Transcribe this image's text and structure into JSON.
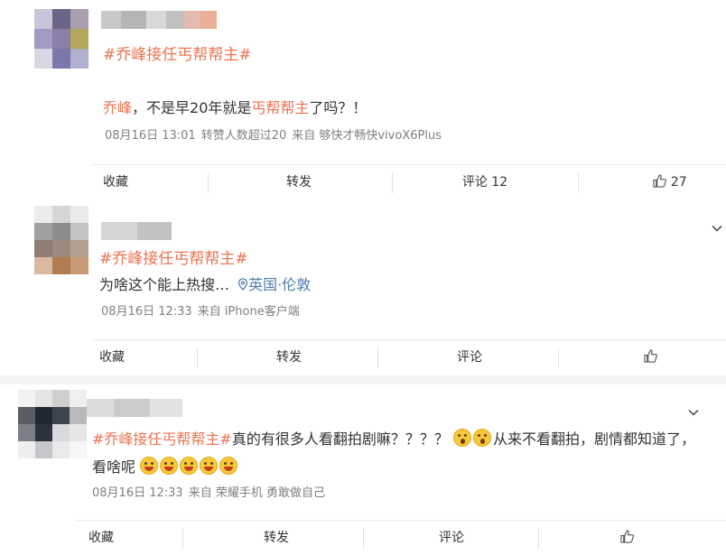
{
  "posts": [
    {
      "topic": "#乔峰接任丐帮帮主#",
      "text": {
        "part1": "乔峰",
        "part2": "，不是早20年就是",
        "part3": "丐帮帮主",
        "part4": "了吗？！"
      },
      "meta": {
        "time": "08月16日 13:01",
        "extra": "转赞人数超过20",
        "source": "来自 够快才畅快vivoX6Plus"
      },
      "actions": {
        "favorite": "收藏",
        "forward": "转发",
        "comment": "评论 12",
        "like_count": "27"
      }
    },
    {
      "topic": "#乔峰接任丐帮帮主#",
      "text": {
        "body": "为啥这个能上热搜…",
        "location": "英国·伦敦"
      },
      "meta": {
        "time": "08月16日 12:33",
        "source": "来自 iPhone客户端"
      },
      "actions": {
        "favorite": "收藏",
        "forward": "转发",
        "comment": "评论",
        "like_count": ""
      }
    },
    {
      "topic": "#乔峰接任丐帮帮主#",
      "text": {
        "line1": "真的有很多人看翻拍剧嘛？？？？",
        "line1b": "从来不看翻拍，剧情都知道了，",
        "line2": "看啥呢"
      },
      "meta": {
        "time": "08月16日 12:33",
        "source": "来自 荣耀手机 勇敢做自己"
      },
      "actions": {
        "favorite": "收藏",
        "forward": "转发",
        "comment": "评论",
        "like_count": ""
      }
    }
  ],
  "icons": {
    "like": "thumbs-up-icon",
    "location": "location-pin-icon",
    "more": "chevron-down-icon",
    "laugh": "laughing-emoji-icon",
    "surprised": "surprised-emoji-icon"
  },
  "colors": {
    "topic": "#eb7350",
    "location": "#507daf",
    "meta": "#808080"
  }
}
